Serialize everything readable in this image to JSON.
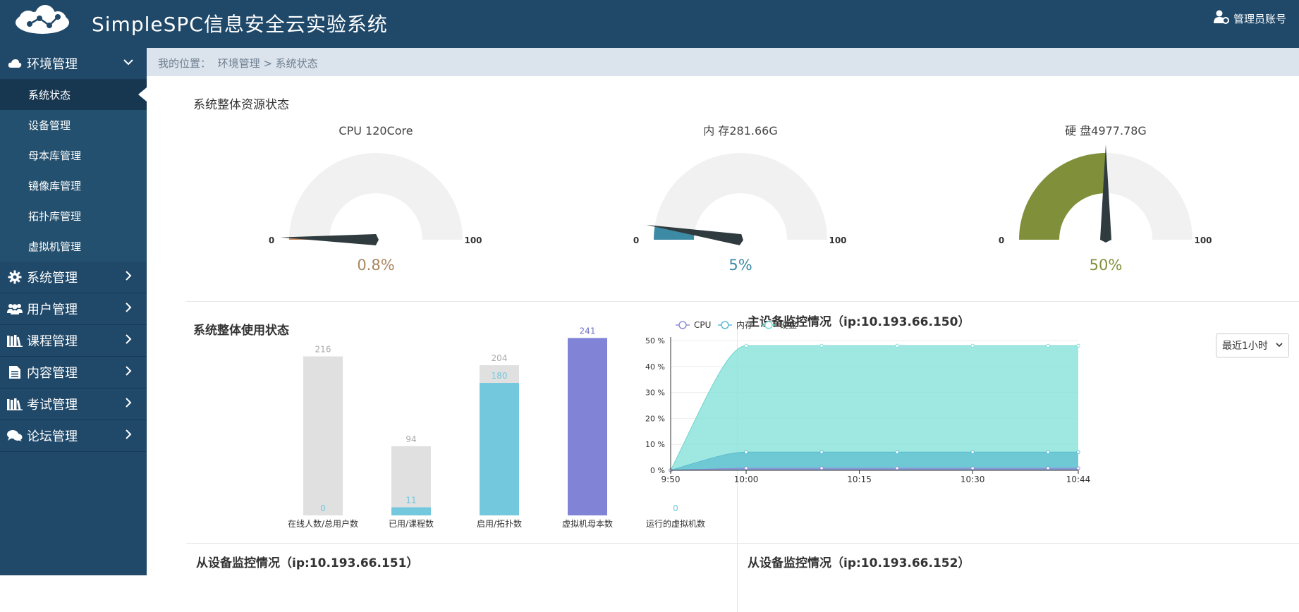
{
  "header": {
    "app_title": "SimpleSPC信息安全云实验系统",
    "user_label": "管理员账号"
  },
  "sidebar": {
    "groups": [
      {
        "label": "环境管理",
        "icon": "cloud-icon",
        "expanded": true,
        "items": [
          {
            "label": "系统状态",
            "active": true
          },
          {
            "label": "设备管理"
          },
          {
            "label": "母本库管理"
          },
          {
            "label": "镜像库管理"
          },
          {
            "label": "拓扑库管理"
          },
          {
            "label": "虚拟机管理"
          }
        ]
      },
      {
        "label": "系统管理",
        "icon": "gear-icon"
      },
      {
        "label": "用户管理",
        "icon": "users-icon"
      },
      {
        "label": "课程管理",
        "icon": "books-icon"
      },
      {
        "label": "内容管理",
        "icon": "document-icon"
      },
      {
        "label": "考试管理",
        "icon": "books-icon"
      },
      {
        "label": "论坛管理",
        "icon": "chat-icon"
      }
    ]
  },
  "breadcrumb": {
    "prefix": "我的位置：",
    "path": "环境管理 > 系统状态"
  },
  "resource": {
    "title": "系统整体资源状态",
    "gauges": [
      {
        "title": "CPU 120Core",
        "min": "0",
        "max": "100",
        "value": 0.8,
        "value_label": "0.8%",
        "color": "#c4845a",
        "label_color": "#a88760"
      },
      {
        "title": "内 存281.66G",
        "min": "0",
        "max": "100",
        "value": 5,
        "value_label": "5%",
        "color": "#3c8aa4",
        "label_color": "#3c8aa4"
      },
      {
        "title": "硬 盘4977.78G",
        "min": "0",
        "max": "100",
        "value": 50,
        "value_label": "50%",
        "color": "#808f3a",
        "label_color": "#808f3a"
      }
    ]
  },
  "usage": {
    "title": "系统整体使用状态",
    "chart_data": {
      "type": "bar",
      "categories": [
        "在线人数/总用户数",
        "已用/课程数",
        "启用/拓扑数",
        "虚拟机母本数",
        "运行的虚拟机数"
      ],
      "series": [
        {
          "values": [
            216,
            94,
            204,
            null,
            null
          ],
          "color": "#e0e0e0"
        },
        {
          "values": [
            0,
            11,
            180,
            241,
            0
          ],
          "color": "#73c8de"
        }
      ]
    }
  },
  "monitor_main": {
    "title": "主设备监控情况（ip:10.193.66.150）",
    "select_value": "最近1小时",
    "chart_data": {
      "type": "area",
      "x": [
        "9:50",
        "10:00",
        "10:10",
        "10:20",
        "10:30",
        "10:40",
        "10:44"
      ],
      "x_ticks": [
        "9:50",
        "10:00",
        "10:15",
        "10:30",
        "10:44"
      ],
      "y_ticks": [
        "50 %",
        "40 %",
        "30 %",
        "20 %",
        "10 %",
        "0 %"
      ],
      "ylim": [
        0,
        50
      ],
      "series": [
        {
          "name": "CPU",
          "values": [
            0,
            0.8,
            0.8,
            0.8,
            0.8,
            0.8,
            0.8
          ],
          "color": "#8f8fd6"
        },
        {
          "name": "内存",
          "values": [
            0,
            7,
            7,
            7,
            7,
            7,
            7
          ],
          "color": "#5bbcd0"
        },
        {
          "name": "硬盘",
          "values": [
            0,
            48,
            48,
            48,
            48,
            48,
            48
          ],
          "color": "#7fe0d8"
        }
      ]
    }
  },
  "monitor_slave1": {
    "title": "从设备监控情况（ip:10.193.66.151）"
  },
  "monitor_slave2": {
    "title": "从设备监控情况（ip:10.193.66.152）"
  }
}
